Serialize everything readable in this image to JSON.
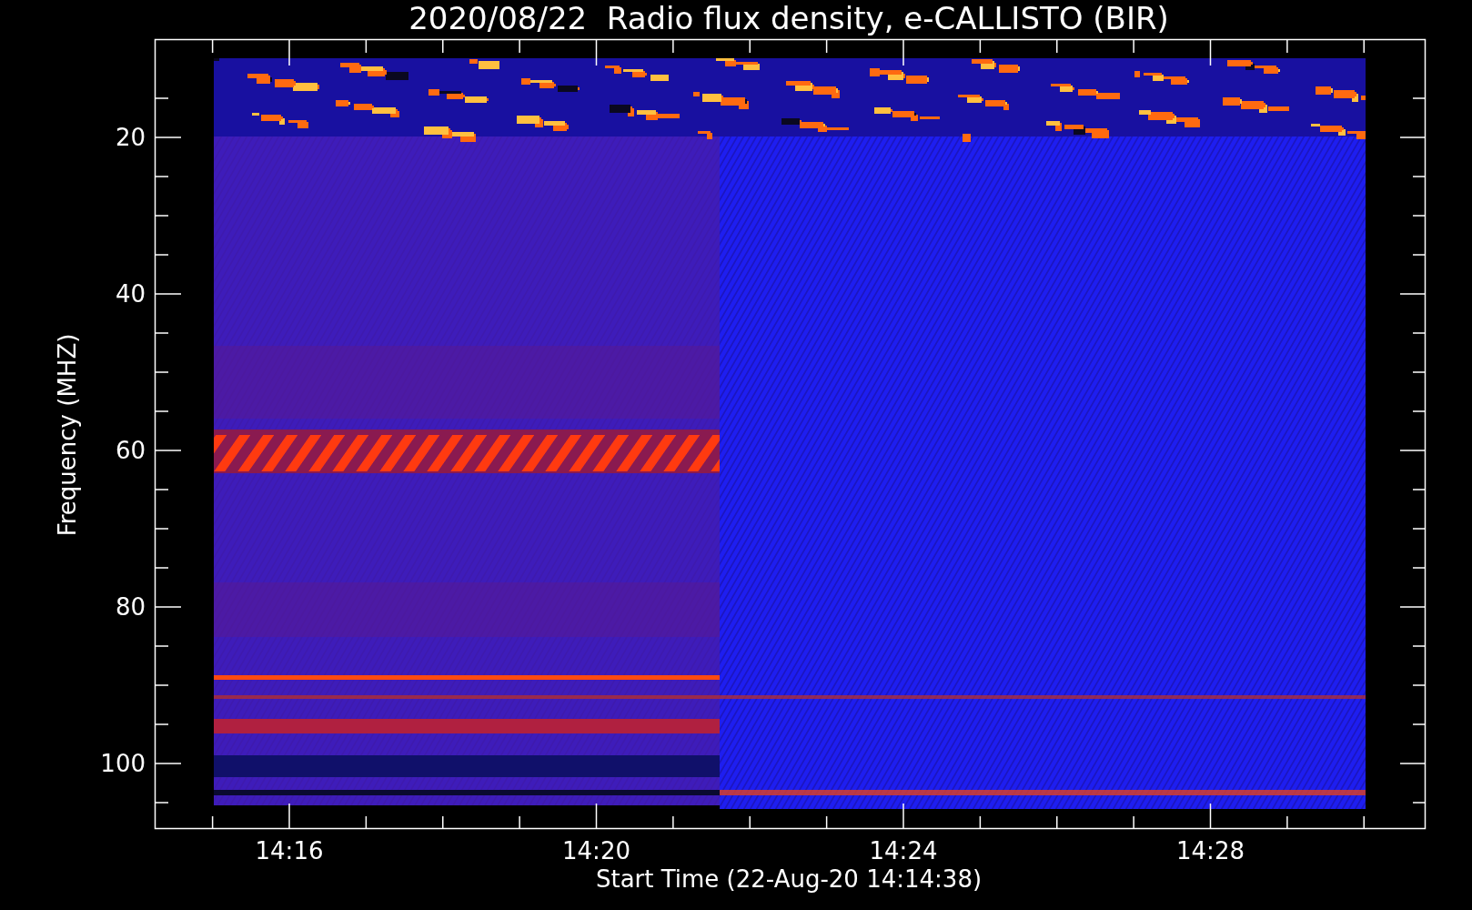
{
  "title": "2020/08/22  Radio flux density, e-CALLISTO (BIR)",
  "plot": {
    "y_label": "Frequency (MHZ)",
    "x_label": "Start Time (22-Aug-20 14:14:38)",
    "y_ticks": [
      "20",
      "40",
      "60",
      "80",
      "100"
    ],
    "x_ticks": [
      "14:16",
      "14:20",
      "14:24",
      "14:28"
    ]
  }
}
